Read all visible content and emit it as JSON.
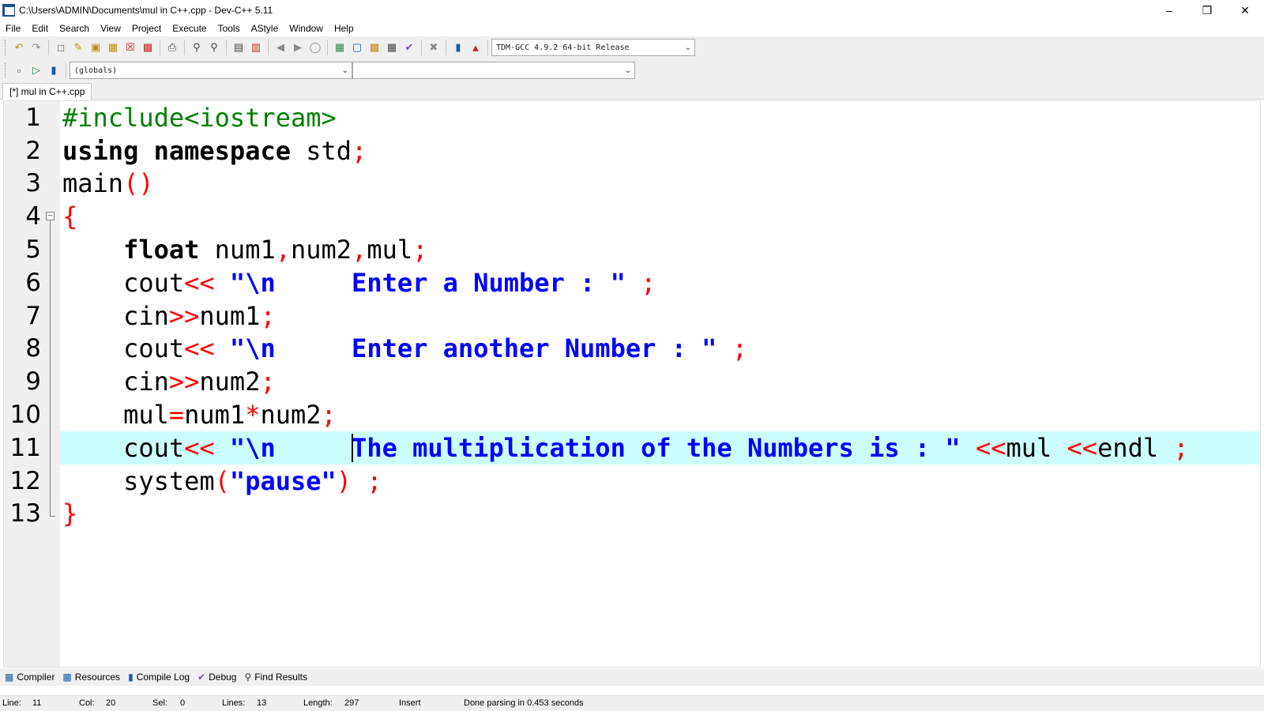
{
  "window": {
    "title": "C:\\Users\\ADMIN\\Documents\\mul in C++.cpp - Dev-C++ 5.11",
    "minimize_icon": "minimize-icon",
    "maximize_icon": "restore-icon",
    "close_icon": "close-icon"
  },
  "menu": [
    "File",
    "Edit",
    "Search",
    "View",
    "Project",
    "Execute",
    "Tools",
    "AStyle",
    "Window",
    "Help"
  ],
  "toolbar": {
    "compiler_select": "TDM-GCC 4.9.2 64-bit Release",
    "scope_select": "(globals)",
    "member_select": ""
  },
  "editor": {
    "tab_label": "[*] mul in C++.cpp",
    "current_line": 11,
    "line_numbers": [
      "1",
      "2",
      "3",
      "4",
      "5",
      "6",
      "7",
      "8",
      "9",
      "10",
      "11",
      "12",
      "13"
    ],
    "lines": [
      [
        {
          "t": "pre",
          "v": "#include<iostream>"
        }
      ],
      [
        {
          "t": "kw",
          "v": "using namespace"
        },
        {
          "t": "id",
          "v": " std"
        },
        {
          "t": "op",
          "v": ";"
        }
      ],
      [
        {
          "t": "id",
          "v": "main"
        },
        {
          "t": "op",
          "v": "()"
        }
      ],
      [
        {
          "t": "op",
          "v": "{"
        }
      ],
      [
        {
          "t": "id",
          "v": "    "
        },
        {
          "t": "kw",
          "v": "float"
        },
        {
          "t": "id",
          "v": " num1"
        },
        {
          "t": "op",
          "v": ","
        },
        {
          "t": "id",
          "v": "num2"
        },
        {
          "t": "op",
          "v": ","
        },
        {
          "t": "id",
          "v": "mul"
        },
        {
          "t": "op",
          "v": ";"
        }
      ],
      [
        {
          "t": "id",
          "v": "    cout"
        },
        {
          "t": "op",
          "v": "<<"
        },
        {
          "t": "id",
          "v": " "
        },
        {
          "t": "str",
          "v": "\"\\n     Enter a Number : \""
        },
        {
          "t": "id",
          "v": " "
        },
        {
          "t": "op",
          "v": ";"
        }
      ],
      [
        {
          "t": "id",
          "v": "    cin"
        },
        {
          "t": "op",
          "v": ">>"
        },
        {
          "t": "id",
          "v": "num1"
        },
        {
          "t": "op",
          "v": ";"
        }
      ],
      [
        {
          "t": "id",
          "v": "    cout"
        },
        {
          "t": "op",
          "v": "<<"
        },
        {
          "t": "id",
          "v": " "
        },
        {
          "t": "str",
          "v": "\"\\n     Enter another Number : \""
        },
        {
          "t": "id",
          "v": " "
        },
        {
          "t": "op",
          "v": ";"
        }
      ],
      [
        {
          "t": "id",
          "v": "    cin"
        },
        {
          "t": "op",
          "v": ">>"
        },
        {
          "t": "id",
          "v": "num2"
        },
        {
          "t": "op",
          "v": ";"
        }
      ],
      [
        {
          "t": "id",
          "v": "    mul"
        },
        {
          "t": "op",
          "v": "="
        },
        {
          "t": "id",
          "v": "num1"
        },
        {
          "t": "op",
          "v": "*"
        },
        {
          "t": "id",
          "v": "num2"
        },
        {
          "t": "op",
          "v": ";"
        }
      ],
      [
        {
          "t": "id",
          "v": "    cout"
        },
        {
          "t": "op",
          "v": "<<"
        },
        {
          "t": "id",
          "v": " "
        },
        {
          "t": "str",
          "v": "\"\\n     "
        },
        {
          "t": "caret",
          "v": ""
        },
        {
          "t": "str",
          "v": "The multiplication of the Numbers is : \""
        },
        {
          "t": "id",
          "v": " "
        },
        {
          "t": "op",
          "v": "<<"
        },
        {
          "t": "id",
          "v": "mul "
        },
        {
          "t": "op",
          "v": "<<"
        },
        {
          "t": "id",
          "v": "endl "
        },
        {
          "t": "op",
          "v": ";"
        }
      ],
      [
        {
          "t": "id",
          "v": "    system"
        },
        {
          "t": "op",
          "v": "("
        },
        {
          "t": "str",
          "v": "\"pause\""
        },
        {
          "t": "op",
          "v": ")"
        },
        {
          "t": "id",
          "v": " "
        },
        {
          "t": "op",
          "v": ";"
        }
      ],
      [
        {
          "t": "op",
          "v": "}"
        }
      ]
    ]
  },
  "bottom_tabs": [
    {
      "label": "Compiler",
      "icon": "grid-icon"
    },
    {
      "label": "Resources",
      "icon": "resources-icon"
    },
    {
      "label": "Compile Log",
      "icon": "chart-icon"
    },
    {
      "label": "Debug",
      "icon": "check-icon"
    },
    {
      "label": "Find Results",
      "icon": "find-icon"
    }
  ],
  "status": {
    "line_label": "Line:",
    "line_value": "11",
    "col_label": "Col:",
    "col_value": "20",
    "sel_label": "Sel:",
    "sel_value": "0",
    "lines_label": "Lines:",
    "lines_value": "13",
    "length_label": "Length:",
    "length_value": "297",
    "mode": "Insert",
    "message": "Done parsing in 0.453 seconds"
  },
  "colors": {
    "preprocessor": "#008000",
    "operator": "#ff0000",
    "string": "#0000ff",
    "current_line_bg": "#ccfffe",
    "gutter_bg": "#f0f0f0"
  }
}
